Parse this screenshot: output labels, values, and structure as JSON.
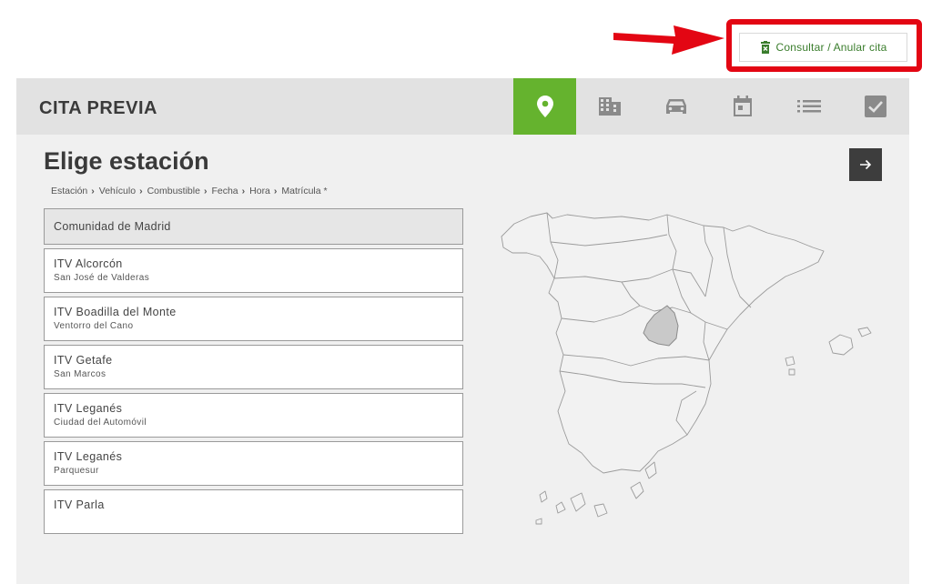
{
  "top": {
    "consultar_label": "Consultar / Anular cita",
    "consultar_icon": "trash-icon"
  },
  "header": {
    "title": "CITA PREVIA",
    "steps": [
      {
        "icon": "location-pin-icon",
        "active": true
      },
      {
        "icon": "building-icon",
        "active": false
      },
      {
        "icon": "car-icon",
        "active": false
      },
      {
        "icon": "calendar-icon",
        "active": false
      },
      {
        "icon": "list-icon",
        "active": false
      },
      {
        "icon": "checkbox-icon",
        "active": false
      }
    ]
  },
  "main": {
    "title": "Elige estación",
    "breadcrumb": [
      "Estación",
      "Vehículo",
      "Combustible",
      "Fecha",
      "Hora",
      "Matrícula *"
    ],
    "region": "Comunidad de Madrid",
    "stations": [
      {
        "name": "ITV Alcorcón",
        "address": "San José de Valderas"
      },
      {
        "name": "ITV Boadilla del Monte",
        "address": "Ventorro del Cano"
      },
      {
        "name": "ITV Getafe",
        "address": "San Marcos"
      },
      {
        "name": "ITV Leganés",
        "address": "Ciudad del Automóvil"
      },
      {
        "name": "ITV Leganés",
        "address": "Parquesur"
      },
      {
        "name": "ITV Parla",
        "address": ""
      }
    ]
  },
  "colors": {
    "accent_green": "#65b32e",
    "annotation_red": "#e30613",
    "dark_button": "#3d3d3d",
    "highlight_region": "#c9c9c9"
  }
}
